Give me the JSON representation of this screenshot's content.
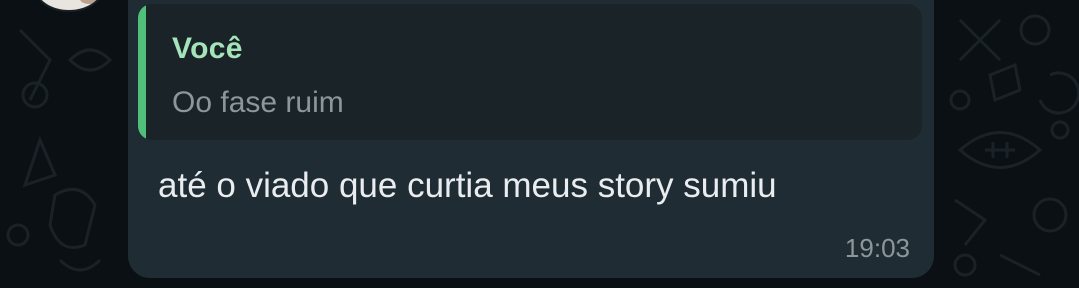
{
  "chat": {
    "reply_preview": {
      "author": "Você",
      "text": "Oo fase ruim"
    },
    "message": {
      "text": "até o viado que curtia meus story sumiu",
      "time": "19:03"
    }
  },
  "colors": {
    "background": "#0b1014",
    "bubble": "#202c33",
    "quote_background": "#1a2328",
    "quote_accent": "#4fbf7a",
    "quote_author": "#a5e3b9",
    "message_text": "#e9edef",
    "secondary_text": "#8c969b"
  },
  "icons": [
    "contact-avatar"
  ]
}
